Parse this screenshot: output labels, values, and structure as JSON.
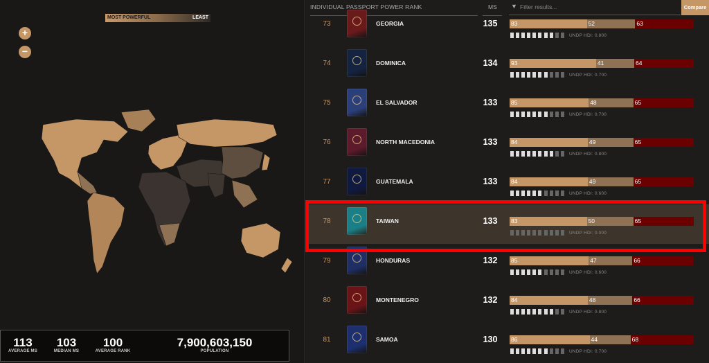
{
  "map": {
    "legend_most": "MOST POWERFUL",
    "legend_least": "LEAST",
    "zoom_in": "+",
    "zoom_out": "−"
  },
  "stats": {
    "average_ms": {
      "value": "113",
      "label": "AVERAGE MS"
    },
    "median_ms": {
      "value": "103",
      "label": "MEDIAN MS"
    },
    "average_rank": {
      "value": "100",
      "label": "AVERAGE RANK"
    },
    "population": {
      "value": "7,900,603,150",
      "label": "POPULATION"
    }
  },
  "list": {
    "title": "INDIVIDUAL PASSPORT POWER RANK",
    "ms_header": "MS",
    "filter_placeholder": "Filter results...",
    "filter_icon": "funnel-icon",
    "compare_label": "Compare",
    "rows": [
      {
        "rank": "73",
        "country": "GEORGIA",
        "ms": "135",
        "free": "83",
        "voa": "52",
        "req": "63",
        "hdi": "UNDP HDI: 0.800",
        "hdi_people": 8,
        "passport_color": "#6b1a1c"
      },
      {
        "rank": "74",
        "country": "DOMINICA",
        "ms": "134",
        "free": "93",
        "voa": "41",
        "req": "64",
        "hdi": "UNDP HDI: 0.700",
        "hdi_people": 7,
        "passport_color": "#14233f"
      },
      {
        "rank": "75",
        "country": "EL SALVADOR",
        "ms": "133",
        "free": "85",
        "voa": "48",
        "req": "65",
        "hdi": "UNDP HDI: 0.700",
        "hdi_people": 7,
        "passport_color": "#2b3f7a"
      },
      {
        "rank": "76",
        "country": "NORTH MACEDONIA",
        "ms": "133",
        "free": "84",
        "voa": "49",
        "req": "65",
        "hdi": "UNDP HDI: 0.800",
        "hdi_people": 8,
        "passport_color": "#5c1a2a"
      },
      {
        "rank": "77",
        "country": "GUATEMALA",
        "ms": "133",
        "free": "84",
        "voa": "49",
        "req": "65",
        "hdi": "UNDP HDI: 0.600",
        "hdi_people": 6,
        "passport_color": "#101a40"
      },
      {
        "rank": "78",
        "country": "TAIWAN",
        "ms": "133",
        "free": "83",
        "voa": "50",
        "req": "65",
        "hdi": "UNDP HDI: 0.000",
        "hdi_people": 0,
        "passport_color": "#1a7f86",
        "selected": true
      },
      {
        "rank": "79",
        "country": "HONDURAS",
        "ms": "132",
        "free": "85",
        "voa": "47",
        "req": "66",
        "hdi": "UNDP HDI: 0.600",
        "hdi_people": 6,
        "passport_color": "#1f2f66"
      },
      {
        "rank": "80",
        "country": "MONTENEGRO",
        "ms": "132",
        "free": "84",
        "voa": "48",
        "req": "66",
        "hdi": "UNDP HDI: 0.800",
        "hdi_people": 8,
        "passport_color": "#6b1418"
      },
      {
        "rank": "81",
        "country": "SAMOA",
        "ms": "130",
        "free": "86",
        "voa": "44",
        "req": "68",
        "hdi": "UNDP HDI: 0.700",
        "hdi_people": 7,
        "passport_color": "#1d2f6e"
      }
    ]
  },
  "colors": {
    "accent": "#c59767",
    "visa_free": "#c59767",
    "visa_on_arrival": "#8f7153",
    "visa_required": "#6b0000",
    "highlight": "#ff0000"
  }
}
